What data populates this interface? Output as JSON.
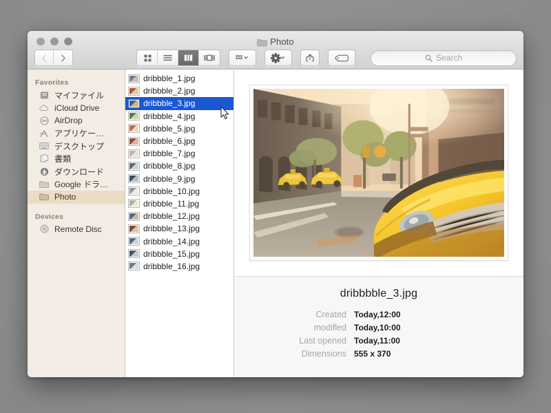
{
  "window": {
    "title": "Photo",
    "title_icon": "folder-icon",
    "traffic_lights": [
      "close-button",
      "minimize-button",
      "zoom-button"
    ]
  },
  "toolbar": {
    "back_icon": "chevron-left-icon",
    "forward_icon": "chevron-right-icon",
    "view_icon_label": "icon-view",
    "view_list_label": "list-view",
    "view_column_label": "column-view",
    "view_coverflow_label": "coverflow-view",
    "active_view": "column-view",
    "arrange_label": "arrange-items",
    "action_label": "action-gear",
    "share_label": "share",
    "tags_label": "edit-tags",
    "search": {
      "placeholder": "Search",
      "value": "",
      "icon": "search-icon"
    }
  },
  "sidebar": {
    "sections": [
      {
        "header": "Favorites",
        "items": [
          {
            "label": "マイファイル",
            "icon": "my-files-icon"
          },
          {
            "label": "iCloud Drive",
            "icon": "cloud-icon"
          },
          {
            "label": "AirDrop",
            "icon": "airdrop-icon"
          },
          {
            "label": "アプリケー…",
            "icon": "applications-icon"
          },
          {
            "label": "デスクトップ",
            "icon": "desktop-icon"
          },
          {
            "label": "書類",
            "icon": "documents-icon"
          },
          {
            "label": "ダウンロード",
            "icon": "downloads-icon"
          },
          {
            "label": "Google ドラ…",
            "icon": "folder-icon"
          },
          {
            "label": "Photo",
            "icon": "folder-icon",
            "selected": true
          }
        ]
      },
      {
        "header": "Devices",
        "items": [
          {
            "label": "Remote Disc",
            "icon": "disc-icon"
          }
        ]
      }
    ]
  },
  "file_list": {
    "selected_index": 2,
    "items": [
      {
        "name": "dribbble_1.jpg"
      },
      {
        "name": "dribbble_2.jpg"
      },
      {
        "name": "dribbble_3.jpg"
      },
      {
        "name": "dribbble_4.jpg"
      },
      {
        "name": "dribbble_5.jpg"
      },
      {
        "name": "dribbble_6.jpg"
      },
      {
        "name": "dribbble_7.jpg"
      },
      {
        "name": "dribbble_8.jpg"
      },
      {
        "name": "dribbble_9.jpg"
      },
      {
        "name": "dribbble_10.jpg"
      },
      {
        "name": "dribbble_11.jpg"
      },
      {
        "name": "dribbble_12.jpg"
      },
      {
        "name": "dribbble_13.jpg"
      },
      {
        "name": "dribbble_14.jpg"
      },
      {
        "name": "dribbble_15.jpg"
      },
      {
        "name": "dribbble_16.jpg"
      }
    ]
  },
  "preview": {
    "alt": "city street with yellow taxi cabs"
  },
  "info": {
    "title": "dribbbble_3.jpg",
    "rows": [
      {
        "key": "Created",
        "value": "Today,12:00"
      },
      {
        "key": "modifled",
        "value": "Today,10:00"
      },
      {
        "key": "Last opened",
        "value": "Today,11:00"
      },
      {
        "key": "Dimensions",
        "value": "555 x 370"
      }
    ]
  },
  "colors": {
    "selection_blue": "#1a57d4",
    "sidebar_bg": "#f3ece4",
    "sidebar_selected": "#ecdcc4",
    "taxi_yellow": "#f4c51c"
  }
}
